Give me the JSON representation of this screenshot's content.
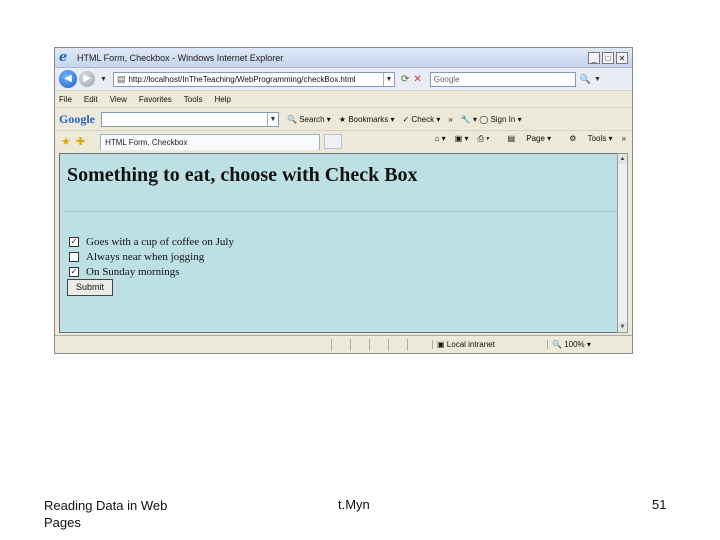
{
  "window": {
    "title": "HTML Form, Checkbox - Windows Internet Explorer",
    "controls": {
      "minimize": "_",
      "maximize": "□",
      "close": "✕"
    }
  },
  "address": {
    "url": "http://localhost/InTheTeaching/WebProgramming/checkBox.html",
    "search_placeholder": "Google"
  },
  "menu": {
    "items": [
      "File",
      "Edit",
      "View",
      "Favorites",
      "Tools",
      "Help"
    ]
  },
  "google_toolbar": {
    "logo": "Google",
    "search_label": "Search",
    "bookmarks_label": "Bookmarks",
    "check_label": "Check",
    "signin_label": "Sign In"
  },
  "tabs": {
    "active_label": "HTML Form, Checkbox"
  },
  "command_bar": {
    "page_label": "Page",
    "tools_label": "Tools"
  },
  "page": {
    "heading": "Something to eat, choose with Check Box",
    "checkboxes": [
      {
        "label": "Goes with a cup of coffee on July",
        "checked": true
      },
      {
        "label": "Always near when jogging",
        "checked": false
      },
      {
        "label": "On Sunday mornings",
        "checked": true
      }
    ],
    "submit_label": "Submit"
  },
  "status": {
    "zone": "Local intranet",
    "zoom": "100%"
  },
  "slide_footer": {
    "left": "Reading Data in Web Pages",
    "center": "t.Myn",
    "page_number": "51"
  },
  "colors": {
    "content_background": "#bde0e4",
    "chrome_background": "#ece9d8"
  }
}
